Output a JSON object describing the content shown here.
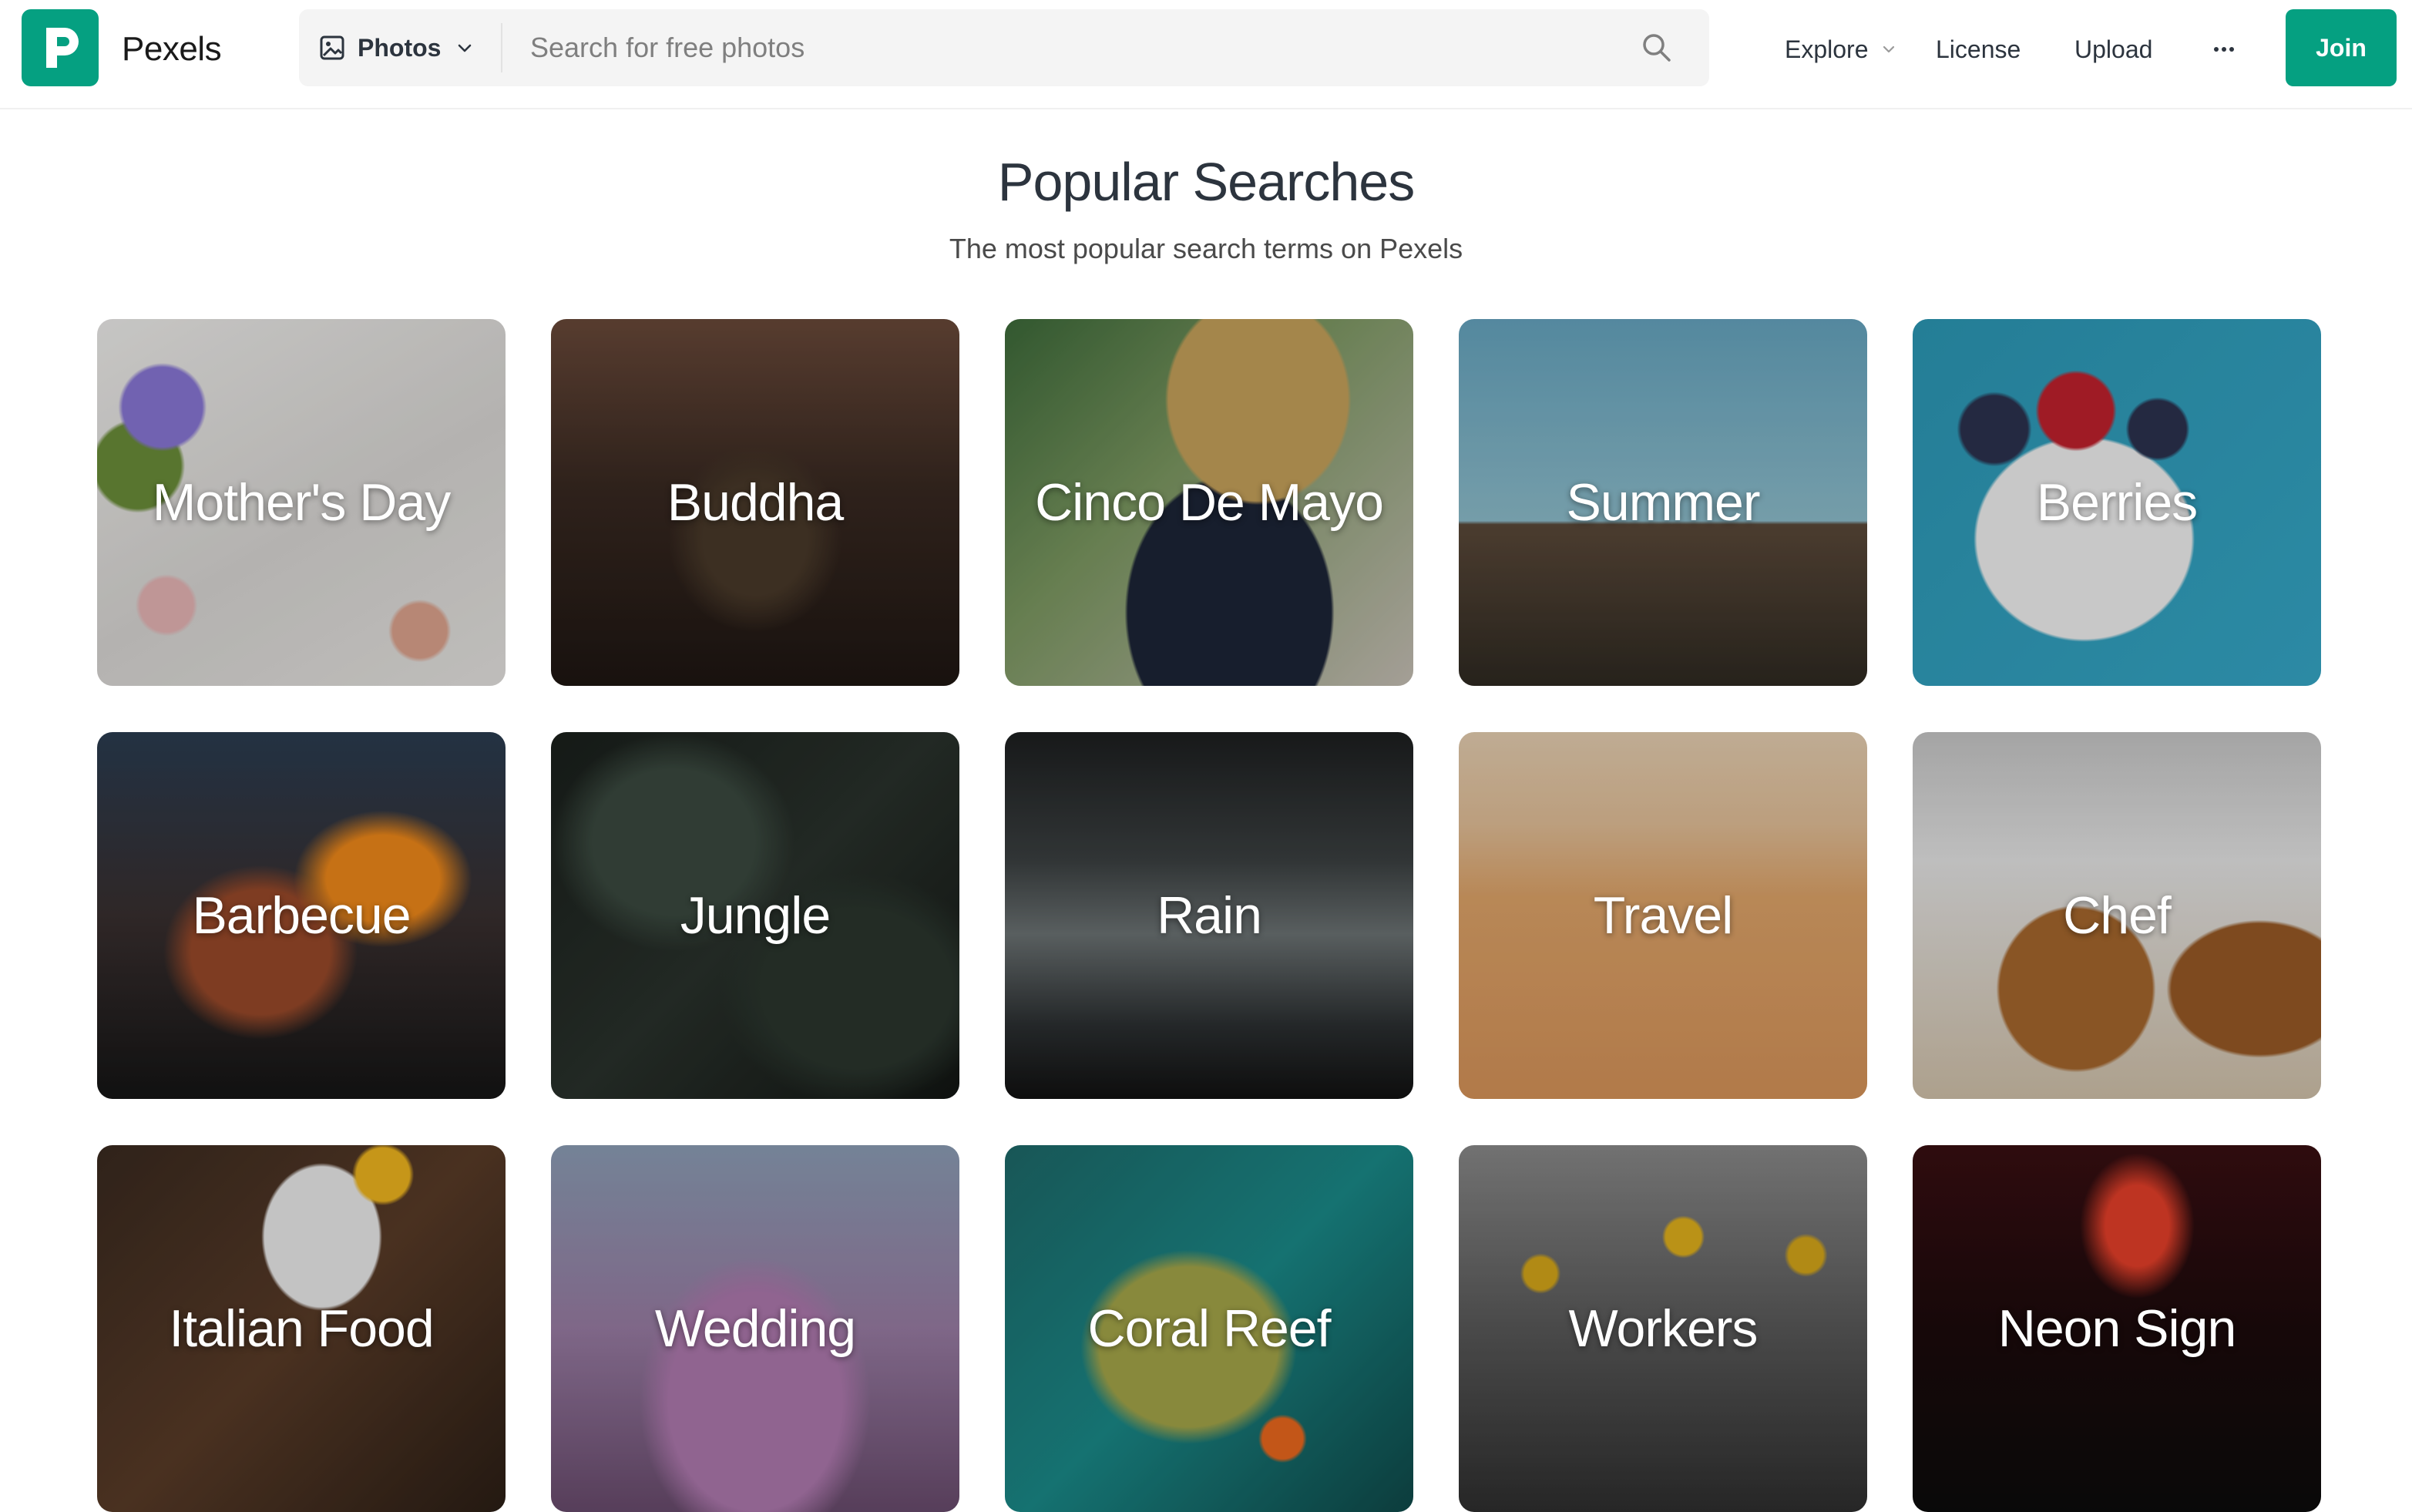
{
  "header": {
    "brand": "Pexels",
    "search_type": "Photos",
    "search_placeholder": "Search for free photos",
    "nav": {
      "explore": "Explore",
      "license": "License",
      "upload": "Upload",
      "join": "Join"
    },
    "icons": {
      "logo": "pexels-logo-icon",
      "type": "image-icon",
      "chevron": "chevron-down-icon",
      "search": "search-icon",
      "more": "more-horizontal-icon"
    },
    "colors": {
      "accent": "#05a081"
    }
  },
  "main": {
    "title": "Popular Searches",
    "subtitle": "The most popular search terms on Pexels",
    "tiles": [
      {
        "label": "Mother's Day"
      },
      {
        "label": "Buddha"
      },
      {
        "label": "Cinco De Mayo"
      },
      {
        "label": "Summer"
      },
      {
        "label": "Berries"
      },
      {
        "label": "Barbecue"
      },
      {
        "label": "Jungle"
      },
      {
        "label": "Rain"
      },
      {
        "label": "Travel"
      },
      {
        "label": "Chef"
      },
      {
        "label": "Italian Food"
      },
      {
        "label": "Wedding"
      },
      {
        "label": "Coral Reef"
      },
      {
        "label": "Workers"
      },
      {
        "label": "Neon Sign"
      }
    ]
  }
}
